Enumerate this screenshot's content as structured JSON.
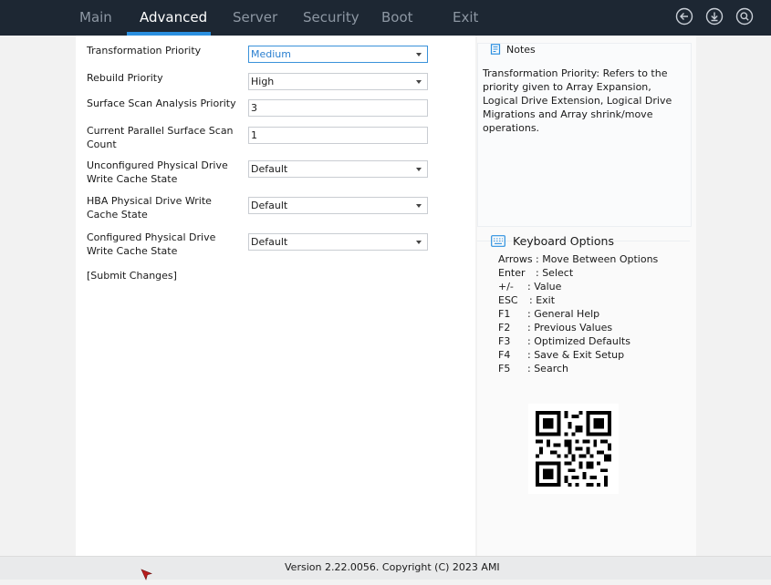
{
  "top_nav": {
    "tabs": [
      "Main",
      "Advanced",
      "Server",
      "Security",
      "Boot",
      "Exit"
    ],
    "active_tab": "Advanced"
  },
  "settings": [
    {
      "label_lines": [
        "Transformation Priority"
      ],
      "value": "Medium",
      "kind": "select",
      "focused": true
    },
    {
      "label_lines": [
        "Rebuild Priority"
      ],
      "value": "High",
      "kind": "select"
    },
    {
      "label_lines": [
        "Surface Scan Analysis Priority"
      ],
      "value": "3",
      "kind": "input"
    },
    {
      "label_lines": [
        "Current Parallel Surface Scan",
        "Count"
      ],
      "value": "1",
      "kind": "input"
    },
    {
      "label_lines": [
        "Unconfigured Physical Drive",
        "Write Cache State"
      ],
      "value": "Default",
      "kind": "select"
    },
    {
      "label_lines": [
        "HBA Physical Drive Write",
        "Cache State"
      ],
      "value": "Default",
      "kind": "select"
    },
    {
      "label_lines": [
        "Configured Physical Drive",
        "Write Cache State"
      ],
      "value": "Default",
      "kind": "select"
    }
  ],
  "submit_label": "[Submit Changes]",
  "notes": {
    "title": "Notes",
    "lines": [
      "Transformation Priority: Refers to the",
      "priority given to Array Expansion,",
      "Logical Drive Extension, Logical Drive",
      "Migrations and Array shrink/move",
      "operations."
    ]
  },
  "keyboard": {
    "title": "Keyboard Options",
    "rows": [
      {
        "key": "Arrows",
        "desc": ": Move Between Options"
      },
      {
        "key": "Enter",
        "desc": ": Select"
      },
      {
        "key": "+/-",
        "desc": ": Value"
      },
      {
        "key": "ESC",
        "desc": ": Exit"
      },
      {
        "key": "F1",
        "desc": ": General Help"
      },
      {
        "key": "F2",
        "desc": ": Previous Values"
      },
      {
        "key": "F3",
        "desc": ": Optimized Defaults"
      },
      {
        "key": "F4",
        "desc": ": Save & Exit Setup"
      },
      {
        "key": "F5",
        "desc": ": Search"
      }
    ]
  },
  "footer": {
    "text": "Version 2.22.0056. Copyright (C) 2023 AMI"
  },
  "colors": {
    "topbar": "#1d2733",
    "accent": "#2a8fe0",
    "inactive_tab": "#8d97a3"
  },
  "icons": [
    "back-icon",
    "download-icon",
    "search-icon",
    "notes-icon",
    "keyboard-icon",
    "qr-code"
  ]
}
